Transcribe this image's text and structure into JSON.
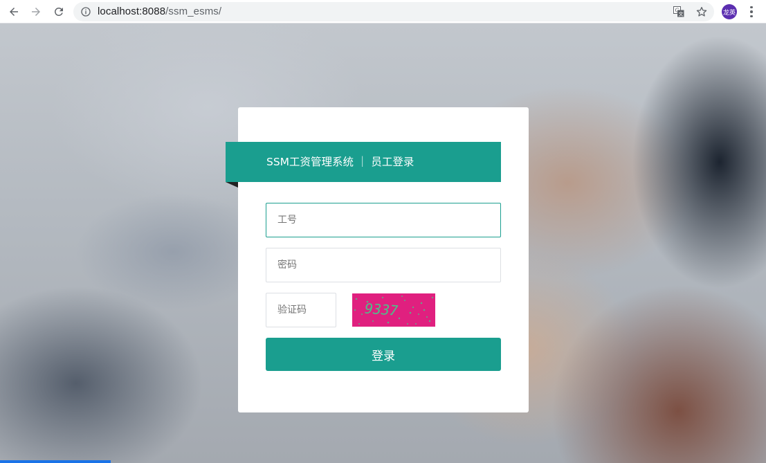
{
  "browser": {
    "url_host": "localhost:8088",
    "url_path": "/ssm_esms/",
    "profile_label": "龙英"
  },
  "icons": {
    "back": "arrow-left-icon",
    "forward": "arrow-right-icon",
    "reload": "reload-icon",
    "info": "info-icon",
    "translate": "translate-icon",
    "bookmark": "star-icon",
    "menu": "more-vert-icon"
  },
  "login": {
    "title": "SSM工资管理系统 ｜ 员工登录",
    "employee_id_placeholder": "工号",
    "password_placeholder": "密码",
    "captcha_placeholder": "验证码",
    "captcha_text": "9337",
    "submit_label": "登录"
  },
  "colors": {
    "accent": "#1a9e8f",
    "captcha_bg": "#e0207f",
    "captcha_text": "#4fbf8a",
    "profile_bg": "#5b2eb0"
  }
}
